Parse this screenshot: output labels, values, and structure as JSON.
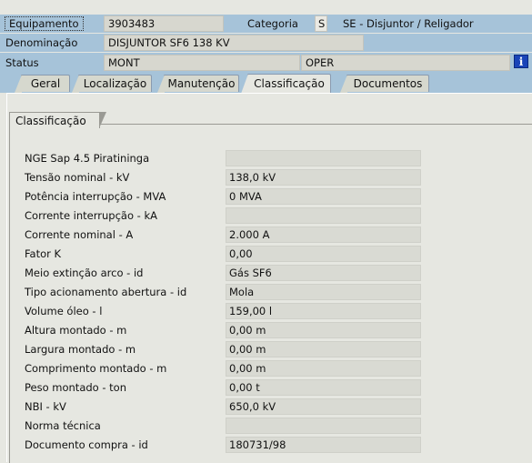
{
  "header": {
    "equipment_label": "Equipamento",
    "equipment_value": "3903483",
    "category_label": "Categoria",
    "category_code": "S",
    "category_desc": "SE - Disjuntor / Religador",
    "denomination_label": "Denominação",
    "denomination_value": "DISJUNTOR SF6 138 KV",
    "status_label": "Status",
    "status_value": "MONT",
    "status_user_value": "OPER",
    "info_icon": "info-icon"
  },
  "tabs": [
    {
      "label": "Geral",
      "active": false
    },
    {
      "label": "Localização",
      "active": false
    },
    {
      "label": "Manutenção",
      "active": false
    },
    {
      "label": "Classificação",
      "active": true
    },
    {
      "label": "Documentos",
      "active": false
    }
  ],
  "group": {
    "title": "Classificação",
    "rows": [
      {
        "label": "NGE Sap 4.5 Piratininga",
        "value": ""
      },
      {
        "label": "Tensão nominal - kV",
        "value": "138,0 kV"
      },
      {
        "label": "Potência interrupção - MVA",
        "value": "0 MVA"
      },
      {
        "label": "Corrente interrupção - kA",
        "value": ""
      },
      {
        "label": "Corrente nominal - A",
        "value": "2.000 A"
      },
      {
        "label": "Fator K",
        "value": "0,00"
      },
      {
        "label": "Meio extinção arco - id",
        "value": "Gás SF6"
      },
      {
        "label": "Tipo acionamento abertura - id",
        "value": "Mola"
      },
      {
        "label": "Volume óleo - l",
        "value": "159,00 l"
      },
      {
        "label": "Altura montado - m",
        "value": "0,00 m"
      },
      {
        "label": "Largura montado - m",
        "value": "0,00 m"
      },
      {
        "label": "Comprimento montado - m",
        "value": "0,00 m"
      },
      {
        "label": "Peso montado - ton",
        "value": "0,00 t"
      },
      {
        "label": "NBI - kV",
        "value": "650,0 kV"
      },
      {
        "label": "Norma técnica",
        "value": ""
      },
      {
        "label": "Documento compra - id",
        "value": "180731/98"
      }
    ]
  }
}
